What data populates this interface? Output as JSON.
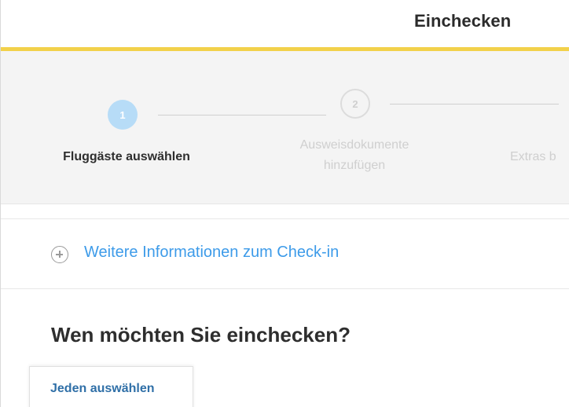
{
  "header": {
    "title": "Einchecken",
    "accent_color": "#f2d14a"
  },
  "stepper": {
    "steps": [
      {
        "number": "1",
        "label": "Fluggäste auswählen",
        "active": true
      },
      {
        "number": "2",
        "label_line1": "Ausweisdokumente",
        "label_line2": "hinzufügen",
        "active": false
      },
      {
        "label": "Extras b",
        "active": false
      }
    ],
    "active_color": "#b7dcf7",
    "inactive_color": "#cfcfcf"
  },
  "info": {
    "icon": "plus-circle-icon",
    "link_text": "Weitere Informationen zum Check-in",
    "link_color": "#3d9be9"
  },
  "main": {
    "question": "Wen möchten Sie einchecken?",
    "select_all_label": "Jeden auswählen"
  }
}
